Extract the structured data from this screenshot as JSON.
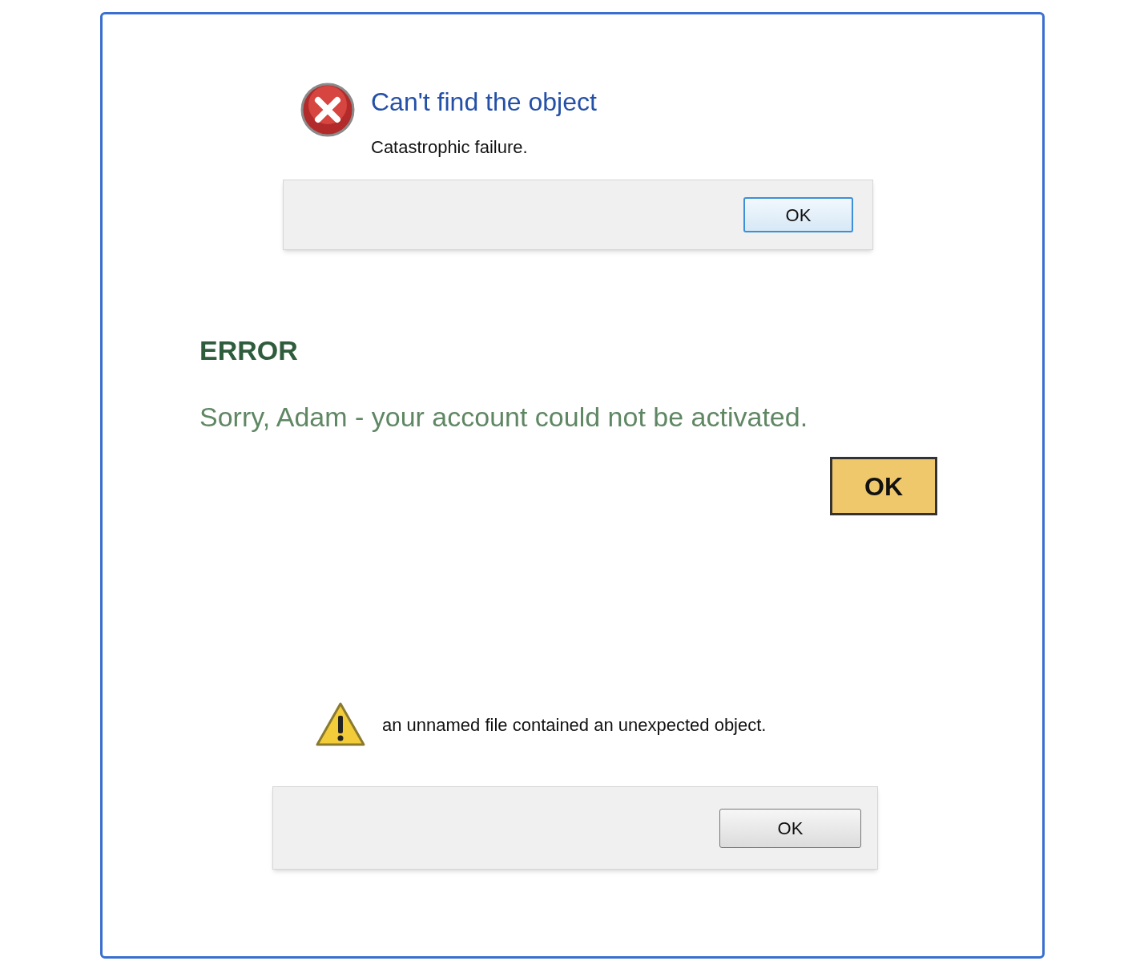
{
  "dialogs": [
    {
      "kind": "error",
      "title": "Can't find the object",
      "message": "Catastrophic failure.",
      "button": "OK"
    },
    {
      "kind": "alert",
      "title": "ERROR",
      "message": "Sorry, Adam - your account could not be activated.",
      "button": "OK"
    },
    {
      "kind": "warning",
      "message": "an unnamed file contained an unexpected object.",
      "button": "OK"
    }
  ]
}
